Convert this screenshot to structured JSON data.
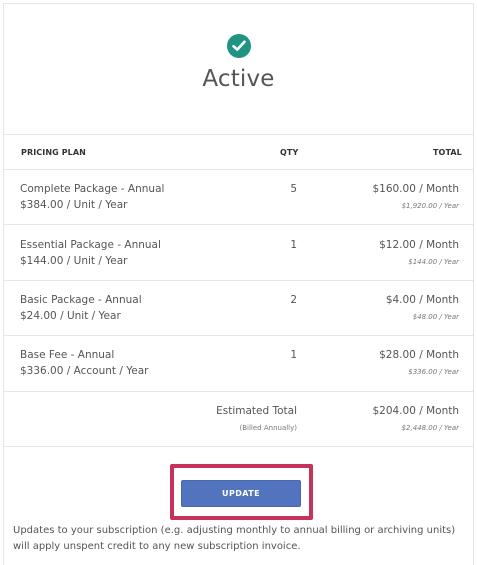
{
  "status": {
    "title": "Active",
    "icon": "check-circle-icon",
    "icon_color": "#1f9483"
  },
  "table": {
    "headers": {
      "plan": "PRICING PLAN",
      "qty": "QTY",
      "total": "TOTAL"
    },
    "rows": [
      {
        "name": "Complete Package - Annual",
        "unit_price": "$384.00 / Unit / Year",
        "qty": "5",
        "monthly": "$160.00 / Month",
        "yearly": "$1,920.00 / Year"
      },
      {
        "name": "Essential Package - Annual",
        "unit_price": "$144.00 / Unit / Year",
        "qty": "1",
        "monthly": "$12.00 / Month",
        "yearly": "$144.00 / Year"
      },
      {
        "name": "Basic Package - Annual",
        "unit_price": "$24.00 / Unit / Year",
        "qty": "2",
        "monthly": "$4.00 / Month",
        "yearly": "$48.00 / Year"
      },
      {
        "name": "Base Fee - Annual",
        "unit_price": "$336.00 / Account / Year",
        "qty": "1",
        "monthly": "$28.00 / Month",
        "yearly": "$336.00 / Year"
      }
    ],
    "estimate": {
      "label": "Estimated Total",
      "note": "(Billed Annually)",
      "monthly": "$204.00 / Month",
      "yearly": "$2,448.00 / Year"
    }
  },
  "actions": {
    "update_label": "UPDATE",
    "highlight_color": "#c7325b",
    "button_color": "#5274bf"
  },
  "footer_note": "Updates to your subscription (e.g. adjusting monthly to annual billing or archiving units) will apply unspent credit to any new subscription invoice."
}
